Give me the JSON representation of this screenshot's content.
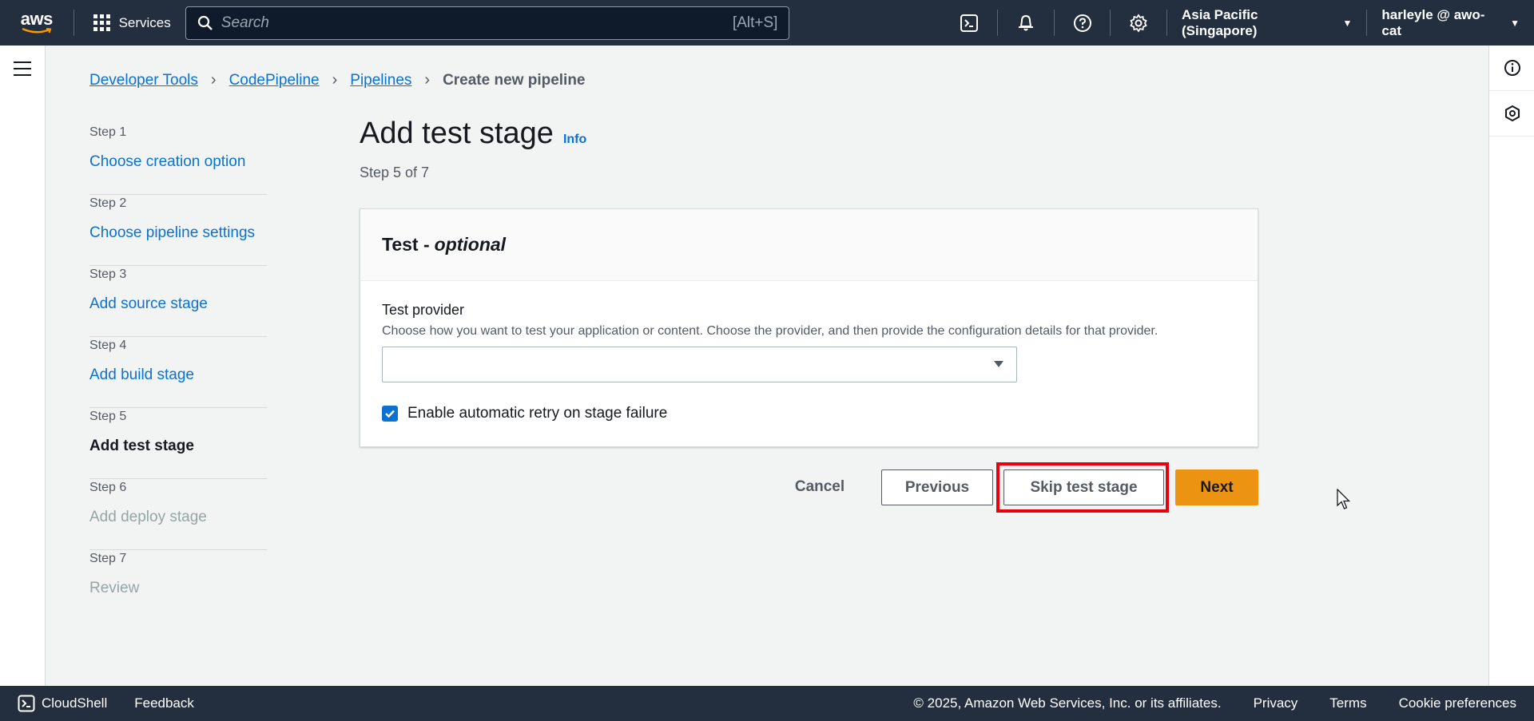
{
  "topnav": {
    "logo_text": "aws",
    "services_label": "Services",
    "search_placeholder": "Search",
    "search_shortcut": "[Alt+S]",
    "region": "Asia Pacific (Singapore)",
    "account": "harleyle @ awo-cat",
    "icons": [
      "cloudshell-icon",
      "bell-icon",
      "help-icon",
      "settings-icon"
    ]
  },
  "breadcrumb": {
    "items": [
      "Developer Tools",
      "CodePipeline",
      "Pipelines"
    ],
    "current": "Create new pipeline"
  },
  "steps": [
    {
      "num": "Step 1",
      "label": "Choose creation option",
      "state": "link"
    },
    {
      "num": "Step 2",
      "label": "Choose pipeline settings",
      "state": "link"
    },
    {
      "num": "Step 3",
      "label": "Add source stage",
      "state": "link"
    },
    {
      "num": "Step 4",
      "label": "Add build stage",
      "state": "link"
    },
    {
      "num": "Step 5",
      "label": "Add test stage",
      "state": "active"
    },
    {
      "num": "Step 6",
      "label": "Add deploy stage",
      "state": "disabled"
    },
    {
      "num": "Step 7",
      "label": "Review",
      "state": "disabled"
    }
  ],
  "main": {
    "title": "Add test stage",
    "info_link": "Info",
    "subtitle": "Step 5 of 7"
  },
  "card": {
    "heading": "Test -",
    "heading_em": "optional",
    "field_label": "Test provider",
    "field_desc": "Choose how you want to test your application or content. Choose the provider, and then provide the configuration details for that provider.",
    "select_value": "",
    "checkbox_label": "Enable automatic retry on stage failure",
    "checkbox_checked": true
  },
  "actions": {
    "cancel": "Cancel",
    "previous": "Previous",
    "skip": "Skip test stage",
    "next": "Next"
  },
  "colors": {
    "nav_bg": "#232f3e",
    "link": "#0972d3",
    "primary_button": "#ec9412",
    "highlight_border": "#e8000f"
  },
  "footer": {
    "cloudshell": "CloudShell",
    "feedback": "Feedback",
    "copyright": "© 2025, Amazon Web Services, Inc. or its affiliates.",
    "privacy": "Privacy",
    "terms": "Terms",
    "cookies": "Cookie preferences"
  }
}
